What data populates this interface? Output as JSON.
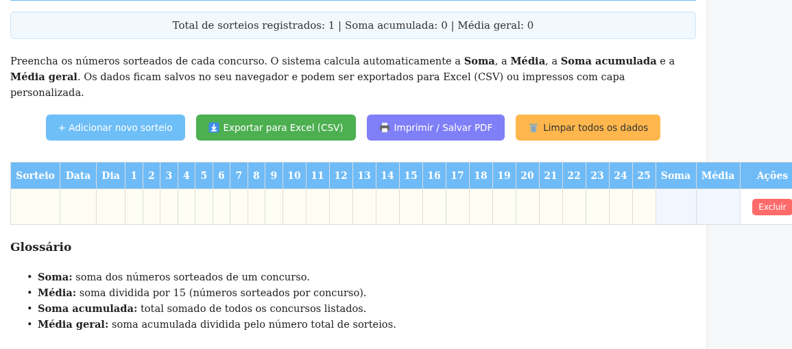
{
  "summary": "Total de sorteios registrados: 1 | Soma acumulada: 0 | Média geral: 0",
  "intro": "Preencha os números sorteados de cada concurso. O sistema calcula automaticamente a **Soma**, a **Média**, a **Soma acumulada** e a **Média geral**. Os dados ficam salvos no seu navegador e podem ser exportados para Excel (CSV) ou impressos com capa personalizada.",
  "buttons": [
    {
      "kind": "add",
      "label": "+ Adicionar novo sorteio"
    },
    {
      "kind": "export",
      "label": "Exportar para Excel (CSV)"
    },
    {
      "kind": "print",
      "label": "Imprimir / Salvar PDF"
    },
    {
      "kind": "clear",
      "label": "Limpar todos os dados"
    }
  ],
  "table": {
    "columns": [
      {
        "label": "Sorteio",
        "kind": "info"
      },
      {
        "label": "Data",
        "kind": "info"
      },
      {
        "label": "Dia",
        "kind": "info"
      },
      {
        "label": "1",
        "kind": "num"
      },
      {
        "label": "2",
        "kind": "num"
      },
      {
        "label": "3",
        "kind": "num"
      },
      {
        "label": "4",
        "kind": "num"
      },
      {
        "label": "5",
        "kind": "num"
      },
      {
        "label": "6",
        "kind": "num"
      },
      {
        "label": "7",
        "kind": "num"
      },
      {
        "label": "8",
        "kind": "num"
      },
      {
        "label": "9",
        "kind": "num"
      },
      {
        "label": "10",
        "kind": "num"
      },
      {
        "label": "11",
        "kind": "num"
      },
      {
        "label": "12",
        "kind": "num"
      },
      {
        "label": "13",
        "kind": "num"
      },
      {
        "label": "14",
        "kind": "num"
      },
      {
        "label": "15",
        "kind": "num"
      },
      {
        "label": "16",
        "kind": "num"
      },
      {
        "label": "17",
        "kind": "num"
      },
      {
        "label": "18",
        "kind": "num"
      },
      {
        "label": "19",
        "kind": "num"
      },
      {
        "label": "20",
        "kind": "num"
      },
      {
        "label": "21",
        "kind": "num"
      },
      {
        "label": "22",
        "kind": "num"
      },
      {
        "label": "23",
        "kind": "num"
      },
      {
        "label": "24",
        "kind": "num"
      },
      {
        "label": "25",
        "kind": "num"
      },
      {
        "label": "Soma",
        "kind": "calc"
      },
      {
        "label": "Média",
        "kind": "calc"
      },
      {
        "label": "Ações",
        "kind": "action"
      }
    ],
    "rows": [
      {
        "action": "Excluir"
      }
    ]
  },
  "glossary": {
    "title": "Glossário",
    "items": [
      {
        "marker": "•",
        "term": "Soma:",
        "text": "soma dos números sorteados de um concurso."
      },
      {
        "marker": "•",
        "term": "Média:",
        "text": "soma dividida por 15 (números sorteados por concurso)."
      },
      {
        "marker": "•",
        "term": "Soma acumulada:",
        "text": "total somado de todos os concursos listados."
      },
      {
        "marker": "•",
        "term": "Média geral:",
        "text": "soma acumulada dividida pelo número total de sorteios."
      }
    ]
  }
}
